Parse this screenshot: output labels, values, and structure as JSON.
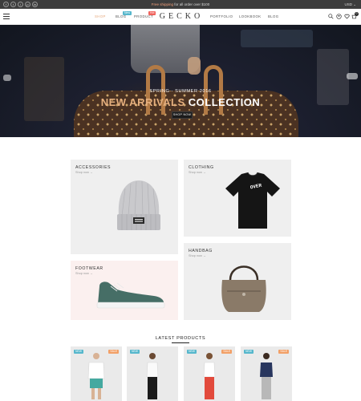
{
  "topbar": {
    "social": [
      {
        "icon": "facebook-icon",
        "glyph": "f"
      },
      {
        "icon": "twitter-icon",
        "glyph": "t"
      },
      {
        "icon": "instagram-icon",
        "glyph": "i"
      },
      {
        "icon": "pinterest-icon",
        "glyph": "p"
      },
      {
        "icon": "linkedin-icon",
        "glyph": "in"
      }
    ],
    "promo_prefix": "Free shipping",
    "promo_suffix": " for all order over $100",
    "currency": "USD ⌄",
    "accent": "#f29f7a"
  },
  "header": {
    "nav_left": [
      {
        "label": "SHOP",
        "active": true
      },
      {
        "label": "BLOG",
        "active": false,
        "badge": "New",
        "badge_color": "#56b7cc"
      },
      {
        "label": "PRODUCT",
        "active": false,
        "badge": "Hot",
        "badge_color": "#f0625c"
      }
    ],
    "logo": "GECKO",
    "nav_right": [
      {
        "label": "PORTFOLIO"
      },
      {
        "label": "LOOKBOOK"
      },
      {
        "label": "BLOG"
      }
    ],
    "icons": [
      "search-icon",
      "account-icon",
      "wishlist-icon",
      "cart-icon"
    ],
    "cart_count": "0"
  },
  "hero": {
    "subtitle": "SPRING - SUMMER 2016",
    "title_accent": "NEW ARRIVALS",
    "title_rest": " COLLECTION",
    "button": "SHOP NOW",
    "accent": "#e6b07e"
  },
  "categories": [
    {
      "title": "ACCESSORIES",
      "link": "Shop now →"
    },
    {
      "title": "CLOTHING",
      "link": "Shop now →",
      "shirt_text": "OVER"
    },
    {
      "title": "FOOTWEAR",
      "link": "Shop now →"
    },
    {
      "title": "HANDBAG",
      "link": "Shop now →"
    }
  ],
  "latest": {
    "title": "LATEST PRODUCTS",
    "products": [
      {
        "new": "NEW",
        "sale": "SALE"
      },
      {
        "new": "NEW"
      },
      {
        "new": "NEW",
        "sale": "SALE"
      },
      {
        "new": "NEW",
        "sale": "SALE"
      }
    ]
  }
}
